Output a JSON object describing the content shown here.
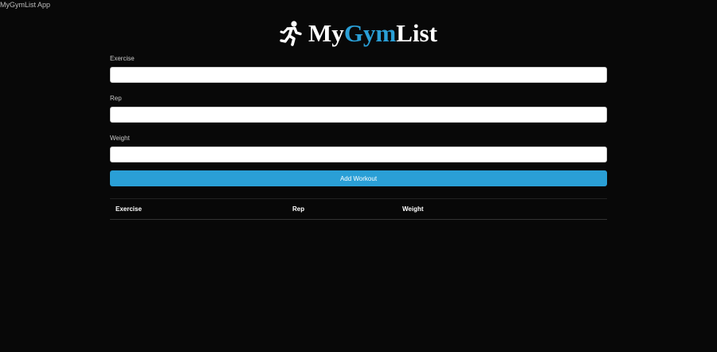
{
  "app": {
    "title": "MyGymList App"
  },
  "logo": {
    "icon": "running-person-icon",
    "text_prefix": "My",
    "text_accent": "Gym",
    "text_suffix": "List",
    "accent_color": "#2a9fd6"
  },
  "form": {
    "exercise_label": "Exercise",
    "exercise_value": "",
    "rep_label": "Rep",
    "rep_value": "",
    "weight_label": "Weight",
    "weight_value": "",
    "submit_label": "Add Workout"
  },
  "table": {
    "headers": [
      "Exercise",
      "Rep",
      "Weight"
    ],
    "rows": []
  }
}
